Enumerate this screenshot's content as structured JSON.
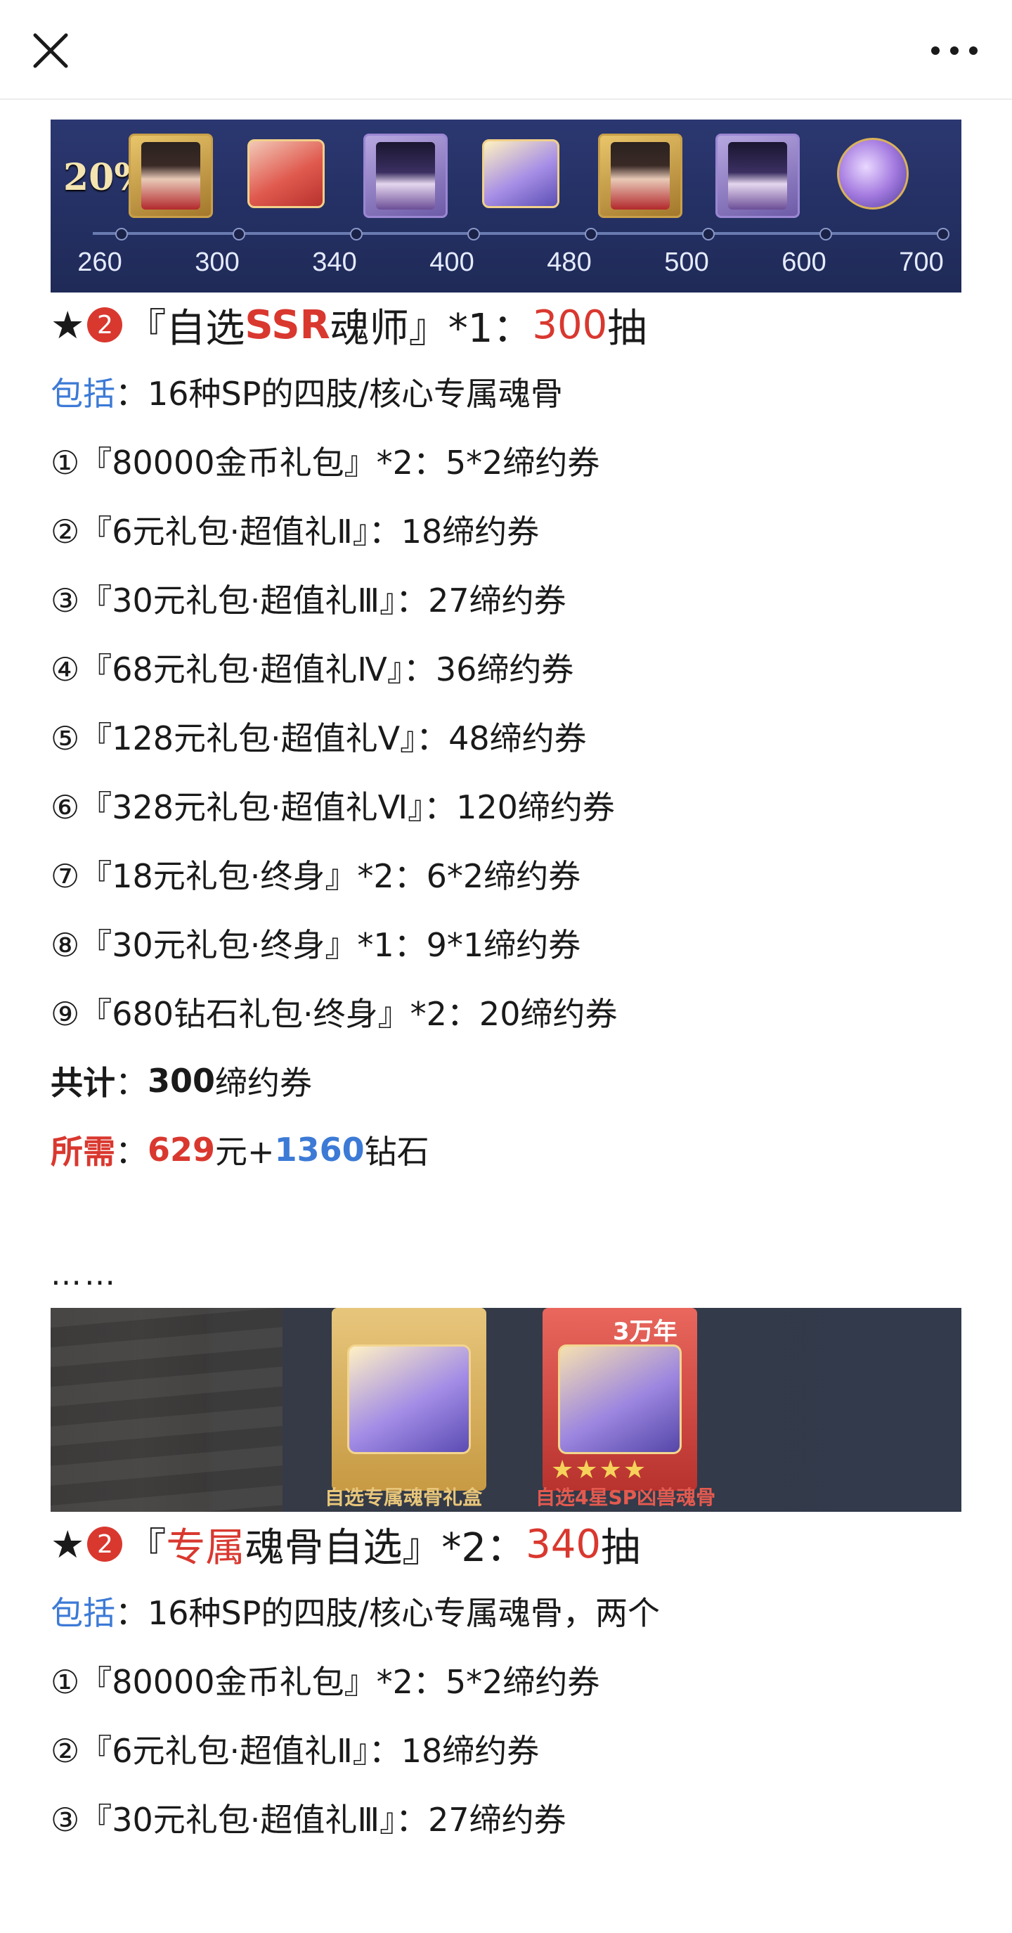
{
  "nav": {
    "close_icon": "close-icon",
    "more_icon": "more-dots-icon"
  },
  "banner1": {
    "percent": "20%",
    "ticks": [
      "260",
      "300",
      "340",
      "400",
      "480",
      "500",
      "600",
      "700"
    ],
    "rewards": [
      "hero-card",
      "red-chest",
      "hero-card-2",
      "gold-chest",
      "hero-card",
      "hero-card-2",
      "orb"
    ]
  },
  "section1": {
    "heading": {
      "star": "★",
      "badge": "2",
      "open": "『自选",
      "accent": "SSR",
      "rest": "魂师』*1：",
      "count": "300",
      "unit": "抽"
    },
    "includes_label": "包括",
    "includes_text": "：16种SP的四肢/核心专属魂骨",
    "items": [
      "①『80000金币礼包』*2：5*2缔约券",
      "②『6元礼包·超值礼Ⅱ』：18缔约券",
      "③『30元礼包·超值礼Ⅲ』：27缔约券",
      "④『68元礼包·超值礼Ⅳ』：36缔约券",
      "⑤『128元礼包·超值礼Ⅴ』：48缔约券",
      "⑥『328元礼包·超值礼Ⅵ』：120缔约券",
      "⑦『18元礼包·终身』*2：6*2缔约券",
      "⑧『30元礼包·终身』*1：9*1缔约券",
      "⑨『680钻石礼包·终身』*2：20缔约券"
    ],
    "total_label": "共计",
    "total_sep": "：",
    "total_value": "300",
    "total_unit": "缔约券",
    "need_label": "所需",
    "need_sep": "：",
    "need_money": "629",
    "need_money_unit": "元+",
    "need_diamond": "1360",
    "need_diamond_unit": "钻石"
  },
  "ellipsis": "……",
  "banner2": {
    "caption_left": "自选专属魂骨礼盒",
    "caption_right": "自选4星SP凶兽魂骨",
    "age_label": "3万年",
    "stars": "★★★★"
  },
  "section2": {
    "heading": {
      "star": "★",
      "badge": "2",
      "open": "『",
      "accent": "专属",
      "rest": "魂骨自选』*2：",
      "count": "340",
      "unit": "抽"
    },
    "includes_label": "包括",
    "includes_text": "：16种SP的四肢/核心专属魂骨，两个",
    "items": [
      "①『80000金币礼包』*2：5*2缔约券",
      "②『6元礼包·超值礼Ⅱ』：18缔约券",
      "③『30元礼包·超值礼Ⅲ』：27缔约券"
    ]
  }
}
